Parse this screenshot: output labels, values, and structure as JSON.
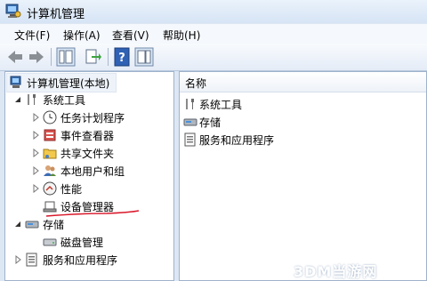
{
  "window": {
    "title": "计算机管理",
    "icon": "computer-management-icon"
  },
  "menu": [
    {
      "label": "文件(F)"
    },
    {
      "label": "操作(A)"
    },
    {
      "label": "查看(V)"
    },
    {
      "label": "帮助(H)"
    }
  ],
  "toolbar": {
    "buttons": [
      "back-icon",
      "forward-icon",
      "show-hide-tree-icon",
      "export-list-icon",
      "help-icon",
      "show-action-pane-icon"
    ]
  },
  "tree": {
    "root": "计算机管理(本地)",
    "system_tools": "系统工具",
    "task_scheduler": "任务计划程序",
    "event_viewer": "事件查看器",
    "shared_folders": "共享文件夹",
    "local_users": "本地用户和组",
    "performance": "性能",
    "device_manager": "设备管理器",
    "storage": "存储",
    "disk_management": "磁盘管理",
    "services_apps": "服务和应用程序"
  },
  "list": {
    "column_name": "名称",
    "items": [
      "系统工具",
      "存储",
      "服务和应用程序"
    ]
  },
  "annotation_color": "#d9182a",
  "watermark": "3DM当游网"
}
